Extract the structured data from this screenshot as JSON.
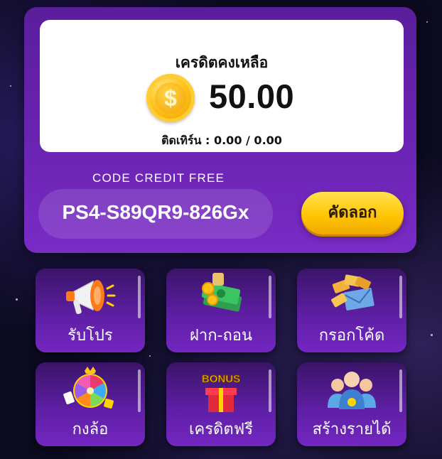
{
  "wallet": {
    "balance_title": "เครดิตคงเหลือ",
    "coin_symbol": "$",
    "balance": "50.00",
    "turnover_label": "ติดเทิร์น :",
    "turnover_value": "0.00 / 0.00"
  },
  "code": {
    "label": "CODE CREDIT FREE",
    "value": "PS4-S89QR9-826Gx",
    "copy_label": "คัดลอก"
  },
  "menu": [
    {
      "label": "รับโปร",
      "icon": "megaphone-icon"
    },
    {
      "label": "ฝาก-ถอน",
      "icon": "money-stack-icon"
    },
    {
      "label": "กรอกโค้ด",
      "icon": "tickets-envelope-icon"
    },
    {
      "label": "กงล้อ",
      "icon": "prize-wheel-icon"
    },
    {
      "label": "เครดิตฟรี",
      "icon": "bonus-gift-icon",
      "badge_text": "BONUS"
    },
    {
      "label": "สร้างรายได้",
      "icon": "team-people-icon"
    }
  ],
  "colors": {
    "card_purple": "#6b24b4",
    "tile_purple": "#5d1fa3",
    "copy_button_yellow": "#ffc300",
    "coin_gold": "#ffc21a",
    "background": "#0b0a1e"
  }
}
